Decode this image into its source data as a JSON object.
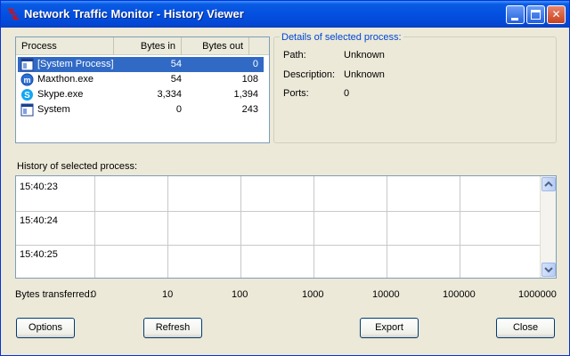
{
  "window": {
    "title": "Network Traffic Monitor - History Viewer",
    "controls": [
      "minimize",
      "maximize",
      "close"
    ],
    "accent_color": "#0450e0"
  },
  "process_list": {
    "columns": [
      "Process",
      "Bytes in",
      "Bytes out"
    ],
    "rows": [
      {
        "name": "[System Process]",
        "bytes_in": "54",
        "bytes_out": "0",
        "icon": "window-app-icon",
        "selected": true
      },
      {
        "name": "Maxthon.exe",
        "bytes_in": "54",
        "bytes_out": "108",
        "icon": "maxthon-icon",
        "selected": false
      },
      {
        "name": "Skype.exe",
        "bytes_in": "3,334",
        "bytes_out": "1,394",
        "icon": "skype-icon",
        "selected": false
      },
      {
        "name": "System",
        "bytes_in": "0",
        "bytes_out": "243",
        "icon": "window-app-icon",
        "selected": false
      }
    ],
    "selection_color": "#316ac5"
  },
  "details": {
    "legend": "Details of selected process:",
    "fields": [
      {
        "label": "Path:",
        "value": "Unknown"
      },
      {
        "label": "Description:",
        "value": "Unknown"
      },
      {
        "label": "Ports:",
        "value": "0"
      }
    ]
  },
  "history": {
    "label": "History of selected process:",
    "times": [
      "15:40:23",
      "15:40:24",
      "15:40:25"
    ],
    "scale_prefix": "Bytes transferred:",
    "scale_ticks": [
      "0",
      "10",
      "100",
      "1000",
      "10000",
      "100000",
      "1000000"
    ]
  },
  "buttons": {
    "options": "Options",
    "refresh": "Refresh",
    "export": "Export",
    "close": "Close"
  }
}
